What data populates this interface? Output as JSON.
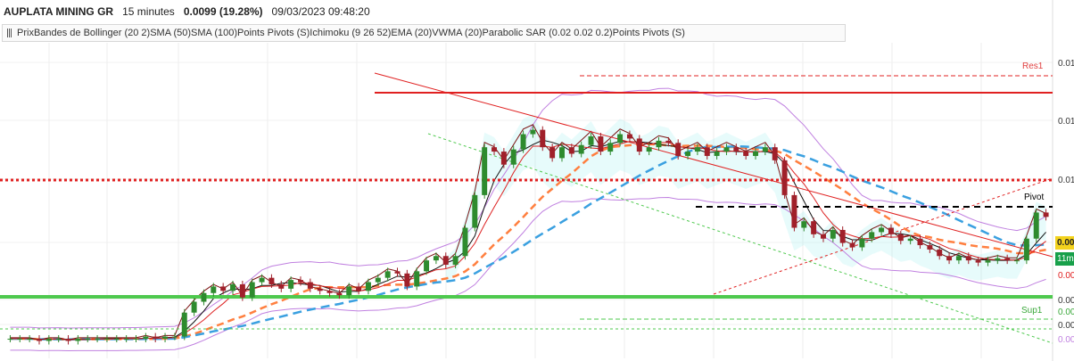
{
  "header": {
    "title": "AUPLATA MINING GR",
    "interval": "15 minutes",
    "last_price": "0.0099 (19.28%)",
    "datetime": "09/03/2023 09:48:20"
  },
  "indicators_label": "PrixBandes de Bollinger (20 2)SMA (50)SMA (100)Points Pivots (S)Ichimoku (9 26 52)EMA (20)VWMA (20)Parabolic SAR (0.02 0.02 0.2)Points Pivots (S)",
  "tags": {
    "price": "0.00",
    "volume": "11m"
  },
  "colors": {
    "up": "#2e8b2e",
    "down": "#a0202a",
    "resistance": "#e02020",
    "support": "#4ec94e",
    "pivot": "#000000",
    "bollinger": "#c080e0",
    "sma50": "#ff7f3f",
    "sma100": "#3aa0e0",
    "ichimoku_cloud": "#a0f0f0",
    "tag_price": "#f3d21d",
    "tag_volume": "#18a04a"
  },
  "chart_data": {
    "type": "candlestick",
    "y_tick_labels": [
      "0.01",
      "0.01",
      "0.01",
      "0.00",
      "0.00",
      "0.00"
    ],
    "levels": [
      {
        "name": "Res1",
        "label": "Res1",
        "value_label": ""
      },
      {
        "name": "Pivot",
        "label": "Pivot",
        "value_label": ""
      },
      {
        "name": "Sup1",
        "label": "Sup1",
        "value_label": "0.00"
      }
    ],
    "right_labels": [
      "0.00",
      "0.00"
    ],
    "close_series": [
      0.0024,
      0.0024,
      0.0024,
      0.0023,
      0.0024,
      0.0024,
      0.0023,
      0.0024,
      0.0024,
      0.0024,
      0.0024,
      0.0024,
      0.0024,
      0.0024,
      0.0025,
      0.0024,
      0.0025,
      0.0025,
      0.0036,
      0.0041,
      0.0045,
      0.0048,
      0.0046,
      0.0049,
      0.0043,
      0.005,
      0.0052,
      0.0049,
      0.0047,
      0.0051,
      0.005,
      0.0047,
      0.0046,
      0.0045,
      0.0044,
      0.0048,
      0.0046,
      0.005,
      0.0052,
      0.0055,
      0.0054,
      0.0048,
      0.0055,
      0.006,
      0.0062,
      0.0058,
      0.0062,
      0.0075,
      0.009,
      0.0112,
      0.011,
      0.0104,
      0.0111,
      0.0118,
      0.012,
      0.0112,
      0.0107,
      0.0112,
      0.0109,
      0.0113,
      0.0117,
      0.011,
      0.0114,
      0.0118,
      0.0116,
      0.011,
      0.0112,
      0.0115,
      0.0114,
      0.0108,
      0.011,
      0.0112,
      0.0108,
      0.011,
      0.0112,
      0.011,
      0.0108,
      0.011,
      0.0112,
      0.0106,
      0.009,
      0.0075,
      0.0078,
      0.0072,
      0.007,
      0.0074,
      0.0068,
      0.0066,
      0.007,
      0.0073,
      0.0075,
      0.0072,
      0.0069,
      0.007,
      0.0067,
      0.0065,
      0.0062,
      0.006,
      0.0062,
      0.006,
      0.0059,
      0.006,
      0.0061,
      0.006,
      0.006,
      0.007,
      0.0082,
      0.008
    ]
  }
}
